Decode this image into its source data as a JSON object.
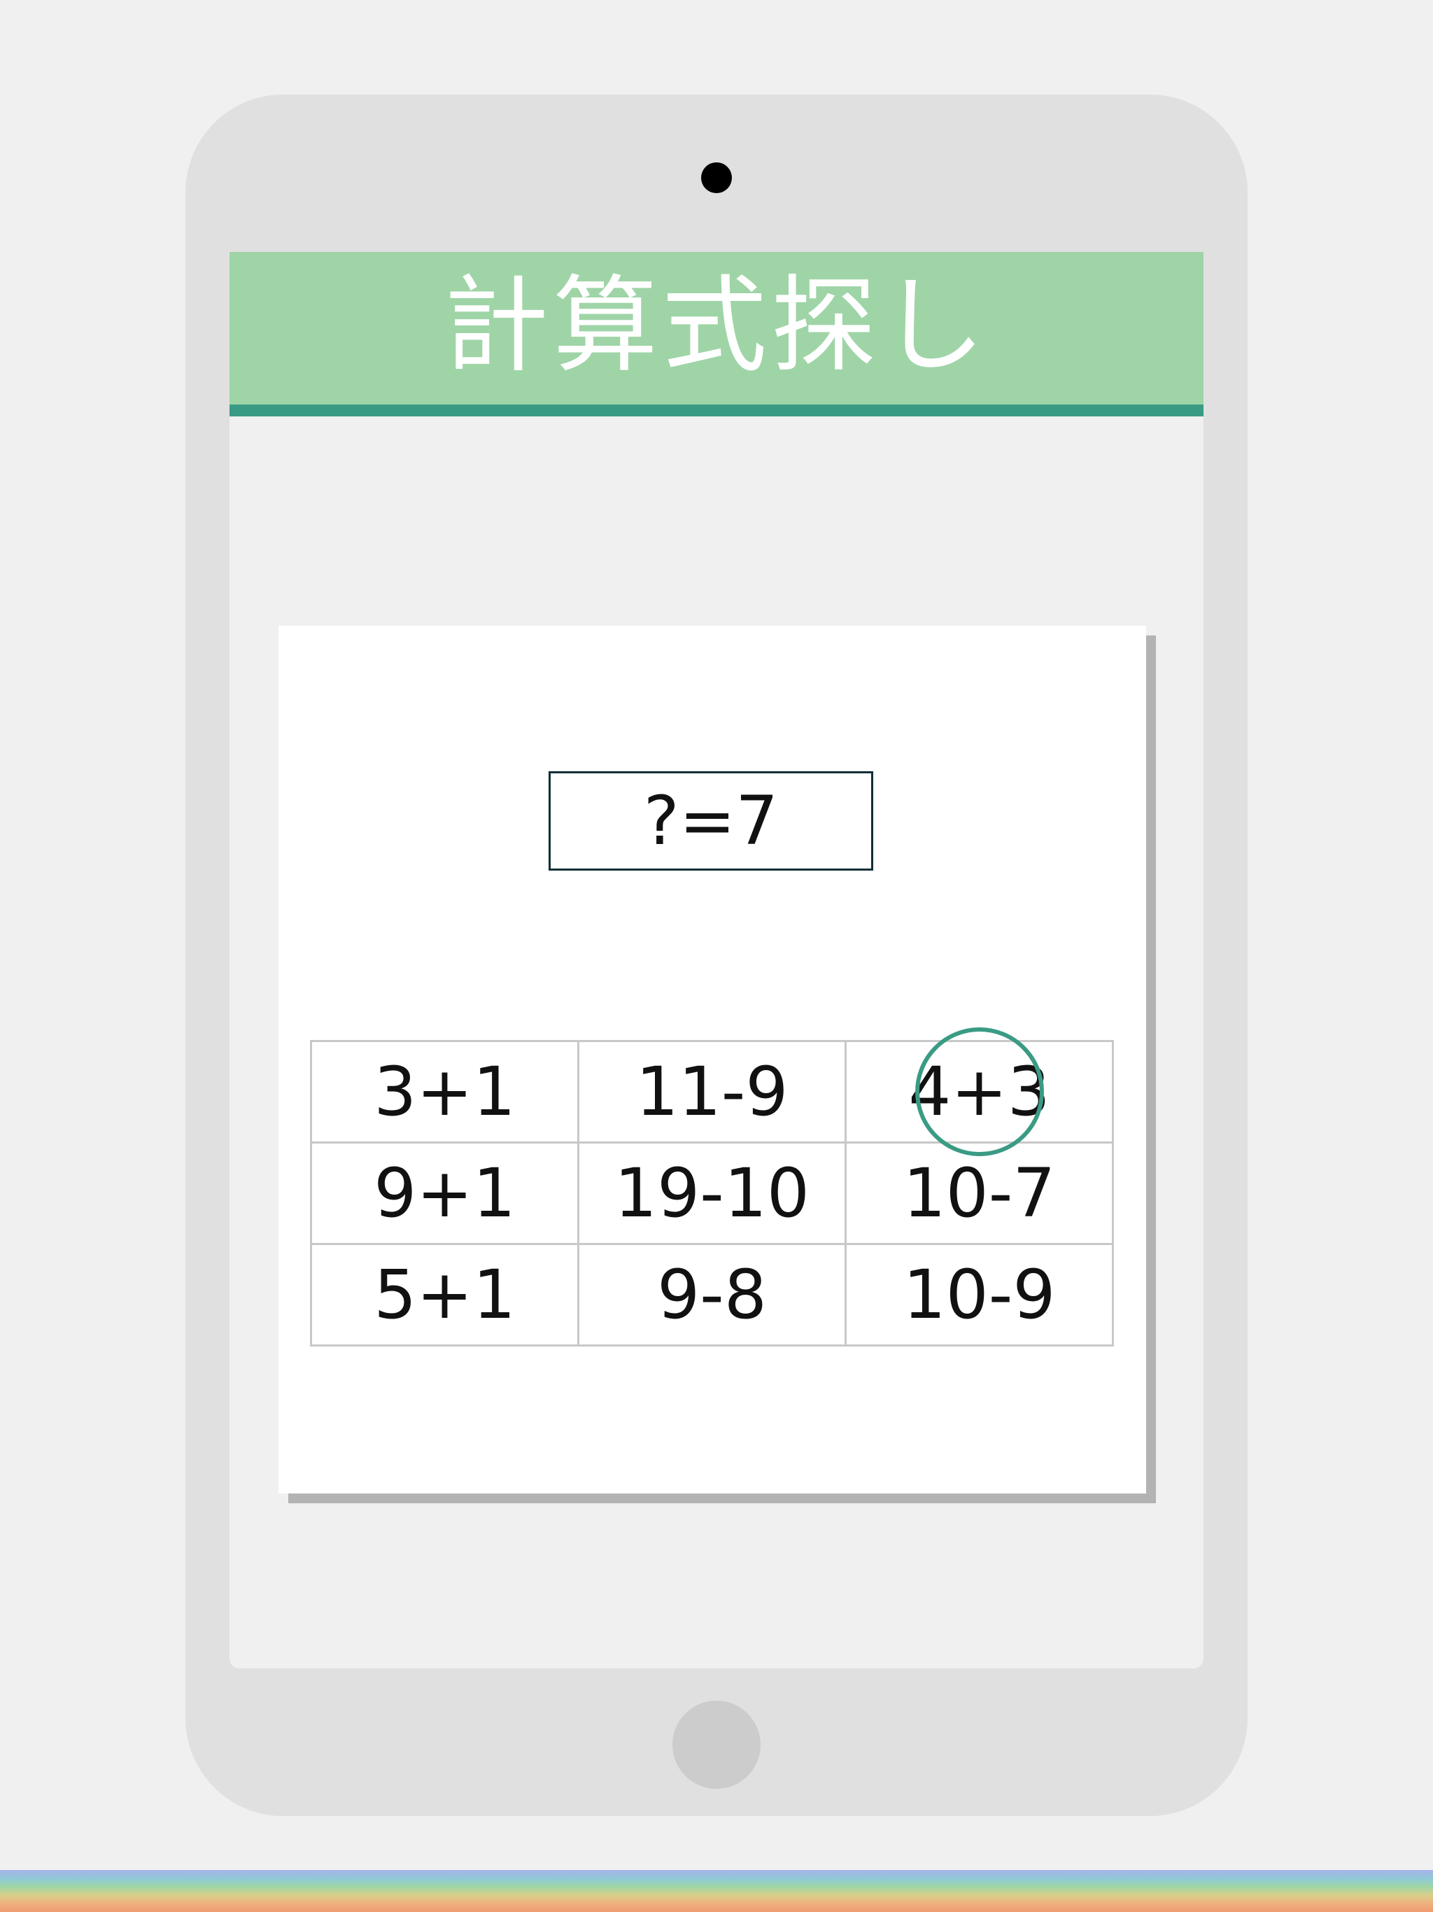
{
  "app": {
    "title": "計算式探し"
  },
  "question": {
    "text": "?=7"
  },
  "grid": {
    "rows": [
      [
        "3+1",
        "11-9",
        "4+3"
      ],
      [
        "9+1",
        "19-10",
        "10-7"
      ],
      [
        "5+1",
        "9-8",
        "10-9"
      ]
    ],
    "selected": "4+3"
  },
  "colors": {
    "header_bg": "#9fd4a7",
    "header_accent": "#3a9b84",
    "selection_circle": "#3a9b84"
  }
}
